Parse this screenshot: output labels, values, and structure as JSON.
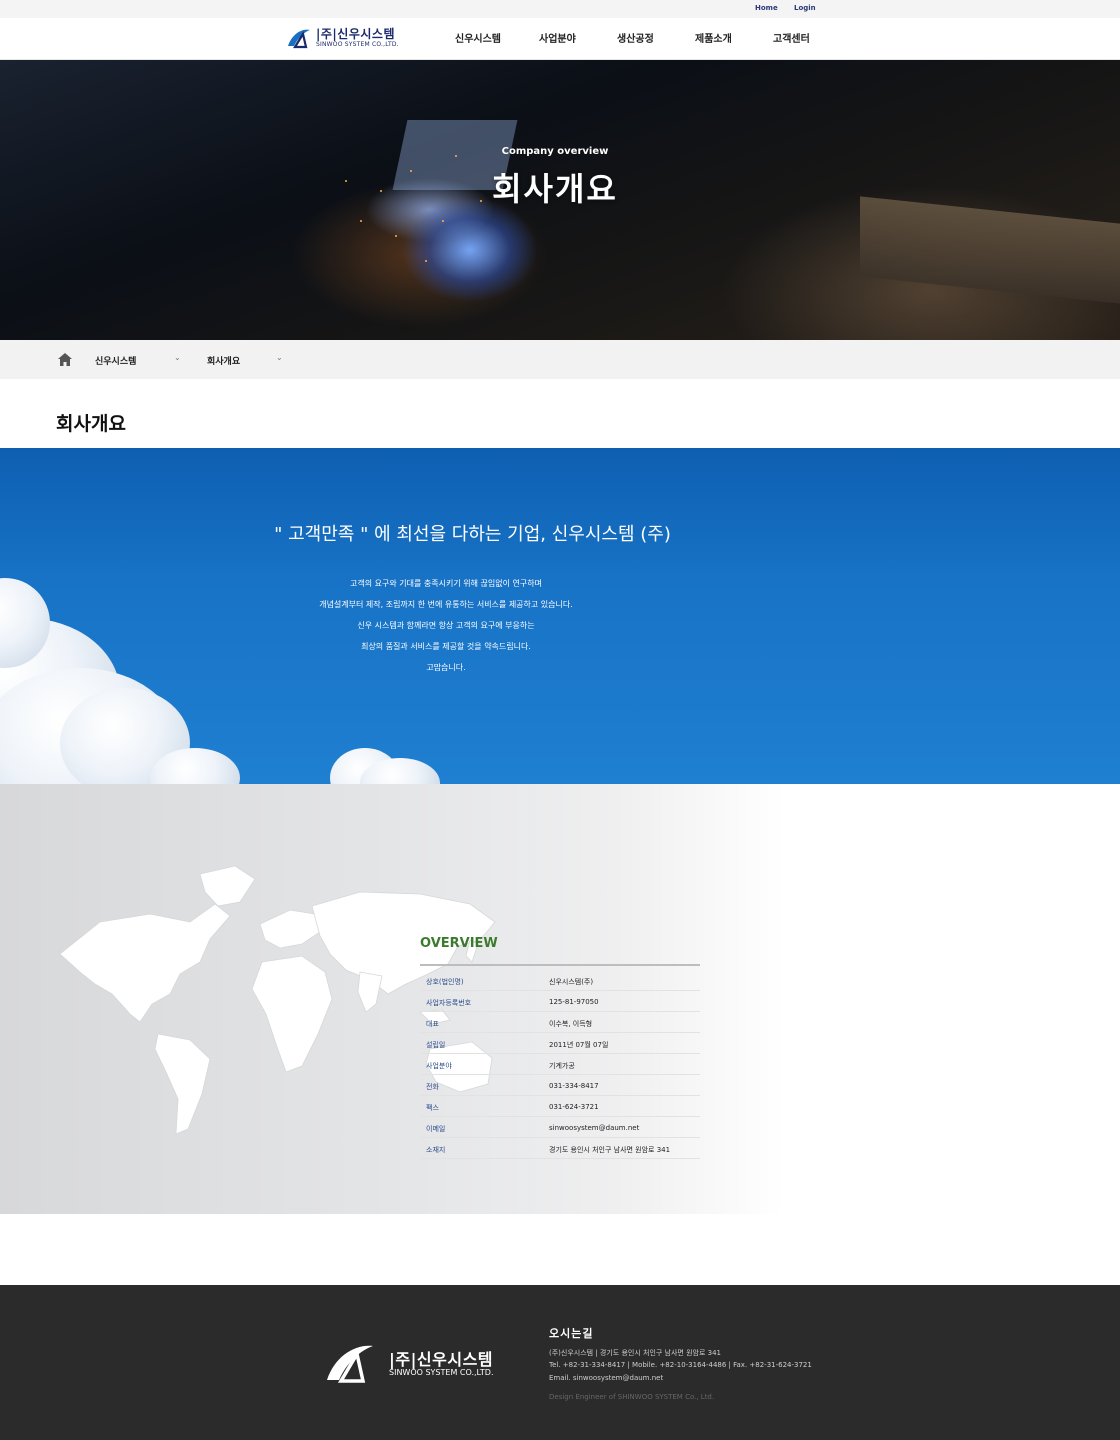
{
  "topbar": {
    "home": "Home",
    "login": "Login"
  },
  "brand": {
    "name_ko": "|주|신우시스템",
    "name_en": "SINWOO SYSTEM CO.,LTD."
  },
  "nav": {
    "items": [
      "신우시스템",
      "사업분야",
      "생산공정",
      "제품소개",
      "고객센터"
    ]
  },
  "hero": {
    "subtitle": "Company overview",
    "title": "회사개요"
  },
  "breadcrumb": {
    "level1": "신우시스템",
    "level2": "회사개요"
  },
  "page_title": "회사개요",
  "intro": {
    "headline": "\" 고객만족 \" 에 최선을 다하는 기업, 신우시스템 (주)",
    "lines": [
      "고객의 요구와 기대를 충족시키기 위해 끊임없이 연구하며",
      "개념설계부터 제작, 조립까지 한 번에 유통하는 서비스를 제공하고 있습니다.",
      "신우 시스템과 함께라면 항상 고객의 요구에 부응하는",
      "최상의 품질과 서비스를 제공할 것을 약속드립니다.",
      "고맙습니다."
    ]
  },
  "overview": {
    "title": "OVERVIEW",
    "rows": [
      {
        "label": "상호(법인명)",
        "value": "신우시스템(주)"
      },
      {
        "label": "사업자등록번호",
        "value": "125-81-97050"
      },
      {
        "label": "대표",
        "value": "이수복, 이득형"
      },
      {
        "label": "설립일",
        "value": "2011년 07월 07일"
      },
      {
        "label": "사업분야",
        "value": "기계가공"
      },
      {
        "label": "전화",
        "value": "031-334-8417"
      },
      {
        "label": "팩스",
        "value": "031-624-3721"
      },
      {
        "label": "이메일",
        "value": "sinwoosystem@daum.net"
      },
      {
        "label": "소재지",
        "value": "경기도 용인시 처인구 남사면 원암로 341"
      }
    ]
  },
  "footer": {
    "heading": "오시는길",
    "address": "(주)신우시스템    |    경기도 용인시 처인구 남사면 원암로 341",
    "contacts": "Tel. +82-31-334-8417    |    Mobile. +82-10-3164-4486    |    Fax. +82-31-624-3721",
    "email": "Email. sinwoosystem@daum.net",
    "copyright": "Design Engineer of SHINWOO SYSTEM Co., Ltd."
  },
  "colors": {
    "brand_navy": "#1b2a6b",
    "sky_blue": "#1873c6",
    "overview_green": "#3c7a2e",
    "footer_bg": "#2b2b2b"
  }
}
